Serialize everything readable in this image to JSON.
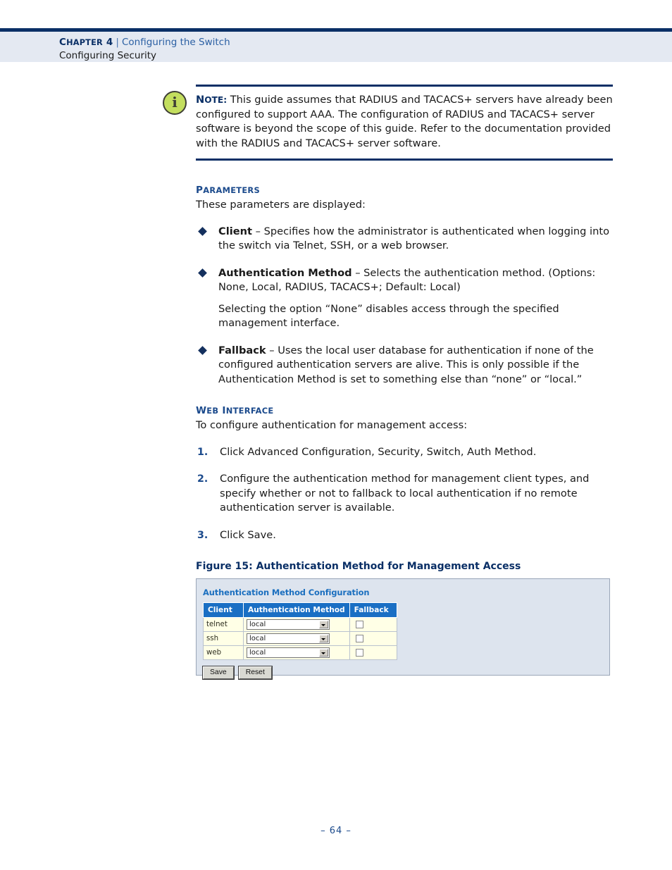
{
  "header": {
    "chapter_label": "Chapter 4",
    "separator": "|",
    "chapter_title": "Configuring the Switch",
    "section_title": "Configuring Security"
  },
  "note": {
    "label": "Note:",
    "icon": "info-icon",
    "text": "This guide assumes that RADIUS and TACACS+ servers have already been configured to support AAA. The configuration of RADIUS and TACACS+ server software is beyond the scope of this guide. Refer to the documentation provided with the RADIUS and TACACS+ server software."
  },
  "parameters_section": {
    "heading": "Parameters",
    "intro": "These parameters are displayed:",
    "bullets": [
      {
        "term": "Client",
        "dash": " – ",
        "text": "Specifies how the administrator is authenticated when logging into the switch via Telnet, SSH, or a web browser."
      },
      {
        "term": "Authentication Method",
        "dash": " – ",
        "text": "Selects the authentication method. (Options: None, Local, RADIUS, TACACS+; Default: Local)"
      },
      {
        "term": "Fallback",
        "dash": " – ",
        "text": "Uses the local user database for authentication if none of the configured authentication servers are alive. This is only possible if the Authentication Method is set to something else than “none” or “local.”"
      }
    ],
    "sub_paragraph": "Selecting the option “None” disables access through the specified management interface."
  },
  "web_interface_section": {
    "heading": "Web Interface",
    "intro": "To configure authentication for management access:",
    "steps": [
      {
        "number": "1.",
        "text": "Click Advanced Configuration, Security, Switch, Auth Method."
      },
      {
        "number": "2.",
        "text": "Configure the authentication method for management client types, and specify whether or not to fallback to local authentication if no remote authentication server is available."
      },
      {
        "number": "3.",
        "text": "Click Save."
      }
    ]
  },
  "figure": {
    "caption": "Figure 15:  Authentication Method for Management Access",
    "panel_title": "Authentication Method Configuration",
    "table": {
      "columns": [
        "Client",
        "Authentication Method",
        "Fallback"
      ],
      "rows": [
        {
          "client": "telnet",
          "method": "local",
          "fallback_checked": false
        },
        {
          "client": "ssh",
          "method": "local",
          "fallback_checked": false
        },
        {
          "client": "web",
          "method": "local",
          "fallback_checked": false
        }
      ]
    },
    "buttons": {
      "save_label": "Save",
      "reset_label": "Reset"
    }
  },
  "footer": {
    "page_number": "–  64  –"
  },
  "colors": {
    "navy": "#0a2f66",
    "link_blue": "#1b4a8c",
    "header_band": "#e4e9f2",
    "figure_bg": "#dde4ee",
    "table_header_blue": "#1a6fc4",
    "table_row_bg": "#ffffe6",
    "note_icon_green": "#c3de5e"
  }
}
